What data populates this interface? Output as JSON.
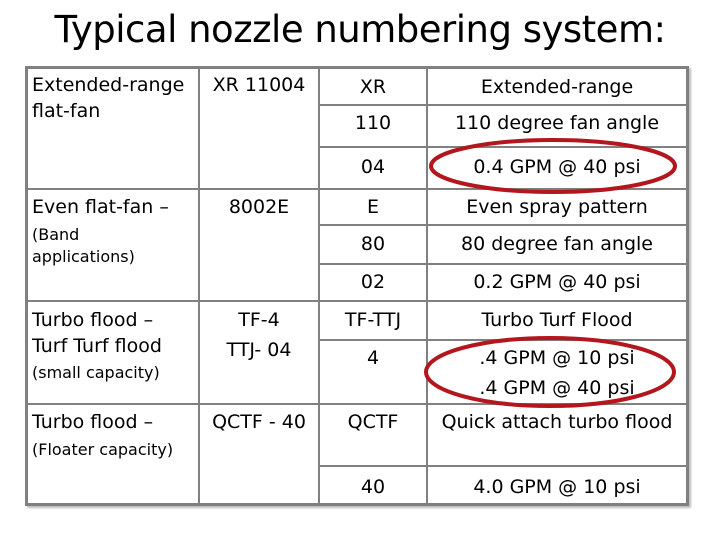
{
  "title": "Typical nozzle numbering system:",
  "rows": [
    {
      "type": "Extended-range",
      "type2": "flat-fan",
      "sub": "",
      "code": "XR 11004",
      "code2": "",
      "parts": [
        {
          "code": "XR",
          "meaning": "Extended-range"
        },
        {
          "code": "110",
          "meaning": "110 degree fan angle"
        },
        {
          "code": "04",
          "meaning": "0.4 GPM @ 40 psi"
        }
      ]
    },
    {
      "type": "Even flat-fan –",
      "type2": "",
      "sub": "(Band applications)",
      "sub1": "(Band",
      "sub2": "applications)",
      "code": "8002E",
      "code2": "",
      "parts": [
        {
          "code": "E",
          "meaning": "Even spray pattern"
        },
        {
          "code": "80",
          "meaning": "80 degree fan angle"
        },
        {
          "code": "02",
          "meaning": "0.2 GPM @ 40 psi"
        }
      ]
    },
    {
      "type": "Turbo flood –",
      "type2": "Turf Turf flood",
      "sub": "(small capacity)",
      "code": "TF-4",
      "code2": "TTJ- 04",
      "parts": [
        {
          "code": "TF-TTJ",
          "meaning": "Turbo Turf Flood"
        },
        {
          "code": "4",
          "meaning": ".4 GPM @ 10 psi",
          "meaning2": ".4 GPM @ 40 psi"
        }
      ]
    },
    {
      "type": "Turbo flood –",
      "type2": "",
      "sub": "(Floater capacity)",
      "code": "QCTF - 40",
      "code2": "",
      "parts": [
        {
          "code": "QCTF",
          "meaning": "Quick attach turbo flood"
        },
        {
          "code": "40",
          "meaning": "4.0 GPM @ 10 psi"
        }
      ]
    }
  ],
  "colors": {
    "border": "#808080",
    "highlight": "#b3161c"
  }
}
